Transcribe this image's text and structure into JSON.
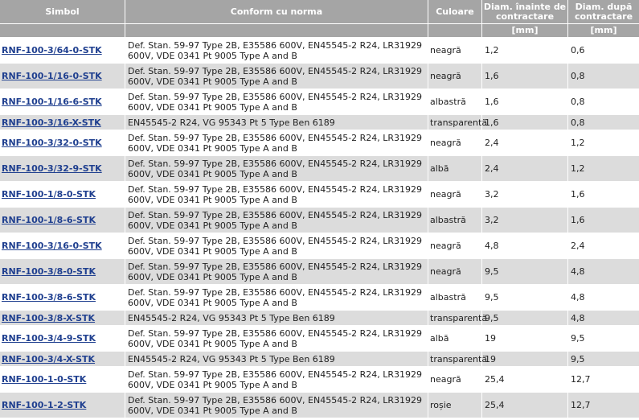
{
  "headers": {
    "symbol": "Simbol",
    "standard": "Conform cu norma",
    "color": "Culoare",
    "diam_before": "Diam. înainte de contractare",
    "diam_after": "Diam. după contractare",
    "unit_before": "[mm]",
    "unit_after": "[mm]"
  },
  "rows": [
    {
      "symbol": "RNF-100-3/64-0-STK",
      "standard": "Def. Stan. 59-97 Type 2B, E35586 600V, EN45545-2 R24, LR31929 600V, VDE 0341 Pt 9005 Type A and B",
      "color": "neagră",
      "before": "1,2",
      "after": "0,6"
    },
    {
      "symbol": "RNF-100-1/16-0-STK",
      "standard": "Def. Stan. 59-97 Type 2B, E35586 600V, EN45545-2 R24, LR31929 600V, VDE 0341 Pt 9005 Type A and B",
      "color": "neagră",
      "before": "1,6",
      "after": "0,8"
    },
    {
      "symbol": "RNF-100-1/16-6-STK",
      "standard": "Def. Stan. 59-97 Type 2B, E35586 600V, EN45545-2 R24, LR31929 600V, VDE 0341 Pt 9005 Type A and B",
      "color": "albastră",
      "before": "1,6",
      "after": "0,8"
    },
    {
      "symbol": "RNF-100-3/16-X-STK",
      "standard": "EN45545-2 R24, VG 95343 Pt 5 Type Ben 6189",
      "color": "transparentă",
      "before": "1,6",
      "after": "0,8"
    },
    {
      "symbol": "RNF-100-3/32-0-STK",
      "standard": "Def. Stan. 59-97 Type 2B, E35586 600V, EN45545-2 R24, LR31929 600V, VDE 0341 Pt 9005 Type A and B",
      "color": "neagră",
      "before": "2,4",
      "after": "1,2"
    },
    {
      "symbol": "RNF-100-3/32-9-STK",
      "standard": "Def. Stan. 59-97 Type 2B, E35586 600V, EN45545-2 R24, LR31929 600V, VDE 0341 Pt 9005 Type A and B",
      "color": "albă",
      "before": "2,4",
      "after": "1,2"
    },
    {
      "symbol": "RNF-100-1/8-0-STK",
      "standard": "Def. Stan. 59-97 Type 2B, E35586 600V, EN45545-2 R24, LR31929 600V, VDE 0341 Pt 9005 Type A and B",
      "color": "neagră",
      "before": "3,2",
      "after": "1,6"
    },
    {
      "symbol": "RNF-100-1/8-6-STK",
      "standard": "Def. Stan. 59-97 Type 2B, E35586 600V, EN45545-2 R24, LR31929 600V, VDE 0341 Pt 9005 Type A and B",
      "color": "albastră",
      "before": "3,2",
      "after": "1,6"
    },
    {
      "symbol": "RNF-100-3/16-0-STK",
      "standard": "Def. Stan. 59-97 Type 2B, E35586 600V, EN45545-2 R24, LR31929 600V, VDE 0341 Pt 9005 Type A and B",
      "color": "neagră",
      "before": "4,8",
      "after": "2,4"
    },
    {
      "symbol": "RNF-100-3/8-0-STK",
      "standard": "Def. Stan. 59-97 Type 2B, E35586 600V, EN45545-2 R24, LR31929 600V, VDE 0341 Pt 9005 Type A and B",
      "color": "neagră",
      "before": "9,5",
      "after": "4,8"
    },
    {
      "symbol": "RNF-100-3/8-6-STK",
      "standard": "Def. Stan. 59-97 Type 2B, E35586 600V, EN45545-2 R24, LR31929 600V, VDE 0341 Pt 9005 Type A and B",
      "color": "albastră",
      "before": "9,5",
      "after": "4,8"
    },
    {
      "symbol": "RNF-100-3/8-X-STK",
      "standard": "EN45545-2 R24, VG 95343 Pt 5 Type Ben 6189",
      "color": "transparentă",
      "before": "9,5",
      "after": "4,8"
    },
    {
      "symbol": "RNF-100-3/4-9-STK",
      "standard": "Def. Stan. 59-97 Type 2B, E35586 600V, EN45545-2 R24, LR31929 600V, VDE 0341 Pt 9005 Type A and B",
      "color": "albă",
      "before": "19",
      "after": "9,5"
    },
    {
      "symbol": "RNF-100-3/4-X-STK",
      "standard": "EN45545-2 R24, VG 95343 Pt 5 Type Ben 6189",
      "color": "transparentă",
      "before": "19",
      "after": "9,5"
    },
    {
      "symbol": "RNF-100-1-0-STK",
      "standard": "Def. Stan. 59-97 Type 2B, E35586 600V, EN45545-2 R24, LR31929 600V, VDE 0341 Pt 9005 Type A and B",
      "color": "neagră",
      "before": "25,4",
      "after": "12,7"
    },
    {
      "symbol": "RNF-100-1-2-STK",
      "standard": "Def. Stan. 59-97 Type 2B, E35586 600V, EN45545-2 R24, LR31929 600V, VDE 0341 Pt 9005 Type A and B",
      "color": "roșie",
      "before": "25,4",
      "after": "12,7"
    }
  ]
}
